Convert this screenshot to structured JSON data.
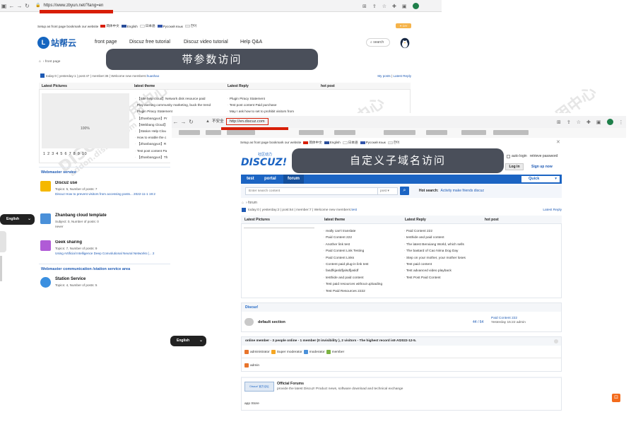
{
  "window1": {
    "url": "https://www.zbyun.net/?lang=en",
    "topbar": {
      "setup": "Setup as front page",
      "bookmark": "bookmark our website",
      "langs": [
        "简体中文",
        "English",
        "日本語",
        "Русский язык",
        "한어"
      ],
      "diy": "DIY"
    },
    "logo_text": "站帮云",
    "nav": [
      "front page",
      "Discuz free tutorial",
      "Discuz video tutorial",
      "Help Q&A"
    ],
    "search_label": "search",
    "breadcrumb": "front page",
    "stats": {
      "today": "today:",
      "today_val": "0",
      "yesterday": "yesterday:",
      "yesterday_val": "1",
      "post": "post:",
      "post_val": "47",
      "member": "member:",
      "member_val": "36",
      "welcome": "Welcome new members:",
      "new_member": "huashao",
      "my_posts": "My posts",
      "latest_reply": "Latest Reply"
    },
    "columns": [
      "Latest Pictures",
      "latest theme",
      "Latest Reply",
      "hot post"
    ],
    "pic_percent": "100%",
    "pager": "1 2 3 4 5 6 7 8 9 10",
    "latest_theme": [
      "【Site help cloud】Network disk resource paid",
      "Play earning community marketing, buck the trend",
      "Plugin Piracy Statement",
      "【Zhanbangyun】Pr",
      "【Webbang Cloud】",
      "【Station Help Clou",
      "How to enable the c",
      "【Zhanbangyun】R",
      "Test post content Pa",
      "【Zhanbangyun】Th"
    ],
    "latest_reply": [
      "Plugin Piracy Statement",
      "Test post content Paid purchase",
      "May I ask how to set to prohibit visitors from"
    ],
    "webmaster_service_title": "Webmaster service",
    "forums_service": [
      {
        "name": "Discuz use",
        "meta": "Topics: 5, Number of posts: 7",
        "last": "Discuz How to prevent visitors from accessing posts... 2022-11-1 19:2",
        "color": "#f5b800"
      },
      {
        "name": "Zhanbang cloud template",
        "meta": "Subject: 0, Number of posts: 0",
        "last": "never",
        "color": "#4a90d9"
      },
      {
        "name": "Geek sharing",
        "meta": "Topics: 7, Number of posts: 9",
        "last": "Using Artificial Intelligence Deep Convolutional Neural Networks (... 2",
        "color": "#b05bd6"
      }
    ],
    "webmaster_comm_title": "Webmaster communication /station service area",
    "forum_station": {
      "name": "Station Service",
      "meta": "Topics: 4, Number of posts: 5",
      "color": "#3a8fe0"
    },
    "lang_pill": "English"
  },
  "banner1": "带参数访问",
  "banner2": "自定义子域名访问",
  "window2": {
    "insecure": "不安全",
    "url": "http://en.discuz.com",
    "topbar": {
      "setup": "Setup as front page",
      "bookmark": "bookmark our website",
      "langs": [
        "简体中文",
        "English",
        "日本語",
        "Русский язык",
        "한어"
      ]
    },
    "logo_main": "DISCUZ!",
    "logo_sub": "社区动力",
    "auto_login": "auto login",
    "retrieve_password": "retrieve password",
    "login": "Log in",
    "sign_up": "Sign up now",
    "nav": [
      "test",
      "portal",
      "forum"
    ],
    "quick": "Quick",
    "search_placeholder": "Enter search content",
    "search_type": "post",
    "hot_search_label": "Hot search:",
    "hot_search": [
      "Activity",
      "make friends",
      "discuz"
    ],
    "breadcrumb": "forum",
    "stats": {
      "today": "today:",
      "today_val": "0",
      "yesterday": "yesterday:",
      "yesterday_val": "2",
      "post": "post:",
      "post_val": "64",
      "member": "member:",
      "member_val": "7",
      "welcome": "Welcome new members:",
      "new_member": "test",
      "latest_reply": "Latest Reply"
    },
    "columns": [
      "Latest Pictures",
      "latest theme",
      "Latest Reply",
      "hot post"
    ],
    "latest_theme": [
      "really can't translate",
      "Paid Content 222",
      "Another link test",
      "Paid Content Link Testing",
      "Paid Content Links",
      "Content paid plug-in link test",
      "fasdfkjasldfjalsdfjasldf",
      "testhide and paid content",
      "Test paid resources without uploading",
      "Test Paid Resources 2222"
    ],
    "latest_reply": [
      "Paid Content 222",
      "testhide and paid content",
      "The latest Benxiang World, which sells",
      "The bastard of Cao Nima Dog Day",
      "Step on your mother, your mother loses",
      "Test paid content",
      "Test advanced video playback",
      "Test Post Paid Content"
    ],
    "discuz_section": "Discuz!",
    "default_section": "default section",
    "default_counts": "44 / 64",
    "default_last_title": "Paid Content 222",
    "default_last_time": "Yesterday 15:22 admin",
    "online": "online member - 3 people online - 1 member (0 invisibility ), 2 visitors - The highest record is9 At2022-12-5.",
    "roles": [
      "administrator",
      "Super moderator",
      "moderator",
      "member"
    ],
    "admin": "admin",
    "official_title": "Official Forums",
    "official_desc": "provide the latest Discuz! Product news, software download and technical exchange",
    "official_badge": "Discuz! 官方论坛",
    "app_store": "app Store",
    "lang_pill": "English"
  },
  "watermark": "DISCUZ!应用中心",
  "watermark_domain": "addon.dismall.com",
  "colors": {
    "discuz_blue": "#1b64c3",
    "red_highlight": "#d81e06",
    "banner_bg": "#4a4f5a"
  }
}
